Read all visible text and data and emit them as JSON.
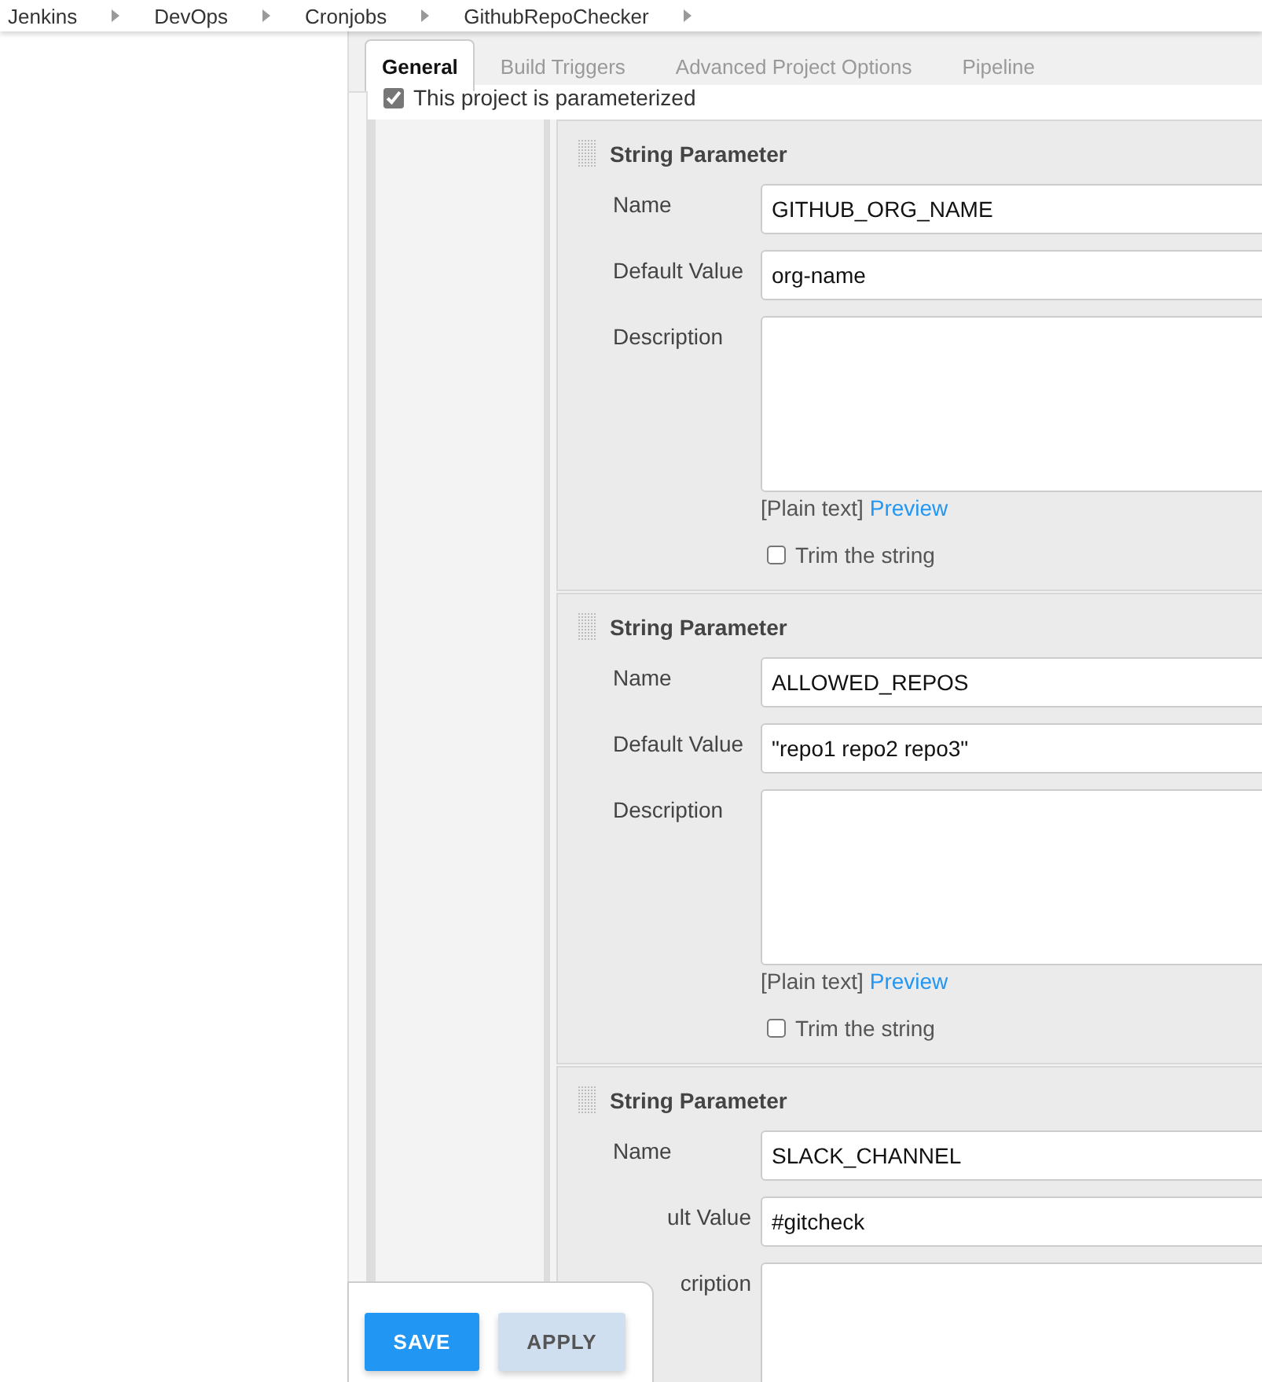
{
  "breadcrumbs": [
    "Jenkins",
    "DevOps",
    "Cronjobs",
    "GithubRepoChecker"
  ],
  "tabs": [
    {
      "label": "General",
      "selected": true
    },
    {
      "label": "Build Triggers",
      "selected": false
    },
    {
      "label": "Advanced Project Options",
      "selected": false
    },
    {
      "label": "Pipeline",
      "selected": false
    }
  ],
  "parameterized": {
    "label": "This project is parameterized",
    "checked": true
  },
  "parameters": [
    {
      "title": "String Parameter",
      "fields": [
        {
          "label": "Name",
          "value": "GITHUB_ORG_NAME",
          "partly_hidden": false
        },
        {
          "label": "Default Value",
          "value": "org-name",
          "partly_hidden": false
        },
        {
          "label": "Description",
          "kind": "textarea",
          "partly_hidden": false
        }
      ],
      "format": "[Plain text]",
      "preview": "Preview",
      "trim": {
        "label": "Trim the string",
        "checked": false
      }
    },
    {
      "title": "String Parameter",
      "fields": [
        {
          "label": "Name",
          "value": "ALLOWED_REPOS",
          "partly_hidden": false
        },
        {
          "label": "Default Value",
          "value": "\"repo1 repo2 repo3\"",
          "partly_hidden": false
        },
        {
          "label": "Description",
          "kind": "textarea",
          "partly_hidden": false
        }
      ],
      "format": "[Plain text]",
      "preview": "Preview",
      "trim": {
        "label": "Trim the string",
        "checked": false
      }
    },
    {
      "title": "String Parameter",
      "fields": [
        {
          "label": "Name",
          "value": "SLACK_CHANNEL",
          "partly_hidden": false
        },
        {
          "label": "ult Value",
          "value": "#gitcheck",
          "partly_hidden": true
        },
        {
          "label": "cription",
          "kind": "textarea",
          "partly_hidden": true
        }
      ]
    }
  ],
  "actions": [
    {
      "label": "SAVE",
      "kind": "primary"
    },
    {
      "label": "APPLY",
      "kind": "secondary"
    }
  ]
}
